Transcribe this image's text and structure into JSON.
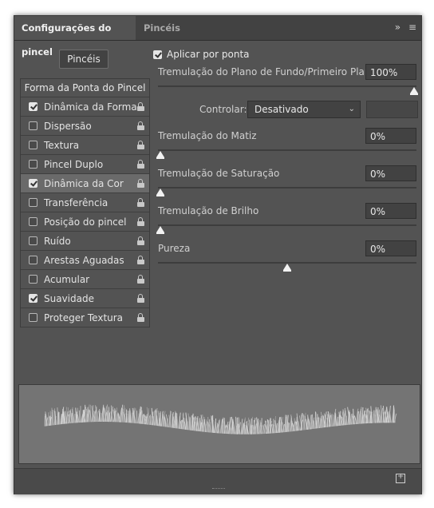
{
  "tabs": [
    {
      "label": "Configurações do pincel",
      "active": true
    },
    {
      "label": "Pincéis",
      "active": false
    }
  ],
  "tab_icons": {
    "expand": "»",
    "menu": "≡"
  },
  "brushes_button": "Pincéis",
  "sidebar": {
    "header": "Forma da Ponta do Pincel",
    "items": [
      {
        "label": "Dinâmica da Forma",
        "checked": true
      },
      {
        "label": "Dispersão",
        "checked": false
      },
      {
        "label": "Textura",
        "checked": false
      },
      {
        "label": "Pincel Duplo",
        "checked": false
      },
      {
        "label": "Dinâmica da Cor",
        "checked": true,
        "selected": true
      },
      {
        "label": "Transferência",
        "checked": false
      },
      {
        "label": "Posição do pincel",
        "checked": false
      },
      {
        "label": "Ruído",
        "checked": false
      },
      {
        "label": "Arestas Aguadas",
        "checked": false
      },
      {
        "label": "Acumular",
        "checked": false
      },
      {
        "label": "Suavidade",
        "checked": true
      },
      {
        "label": "Proteger Textura",
        "checked": false
      }
    ]
  },
  "apply_per_tip": {
    "label": "Aplicar por ponta",
    "checked": true
  },
  "controls": {
    "fg_bg_jitter": {
      "label": "Tremulação do Plano de Fundo/Primeiro Plano",
      "value": "100%",
      "level": 1.0
    },
    "control": {
      "label": "Controlar:",
      "value": "Desativado"
    },
    "hue_jitter": {
      "label": "Tremulação do Matiz",
      "value": "0%",
      "level": 0.0
    },
    "saturation_jitter": {
      "label": "Tremulação de Saturação",
      "value": "0%",
      "level": 0.0
    },
    "brightness_jitter": {
      "label": "Tremulação de Brilho",
      "value": "0%",
      "level": 0.0
    },
    "purity": {
      "label": "Pureza",
      "value": "0%",
      "level": 0.5
    }
  },
  "colors": {
    "panel": "#535353",
    "tabbar": "#424242",
    "field": "#424242",
    "preview": "#747474"
  }
}
